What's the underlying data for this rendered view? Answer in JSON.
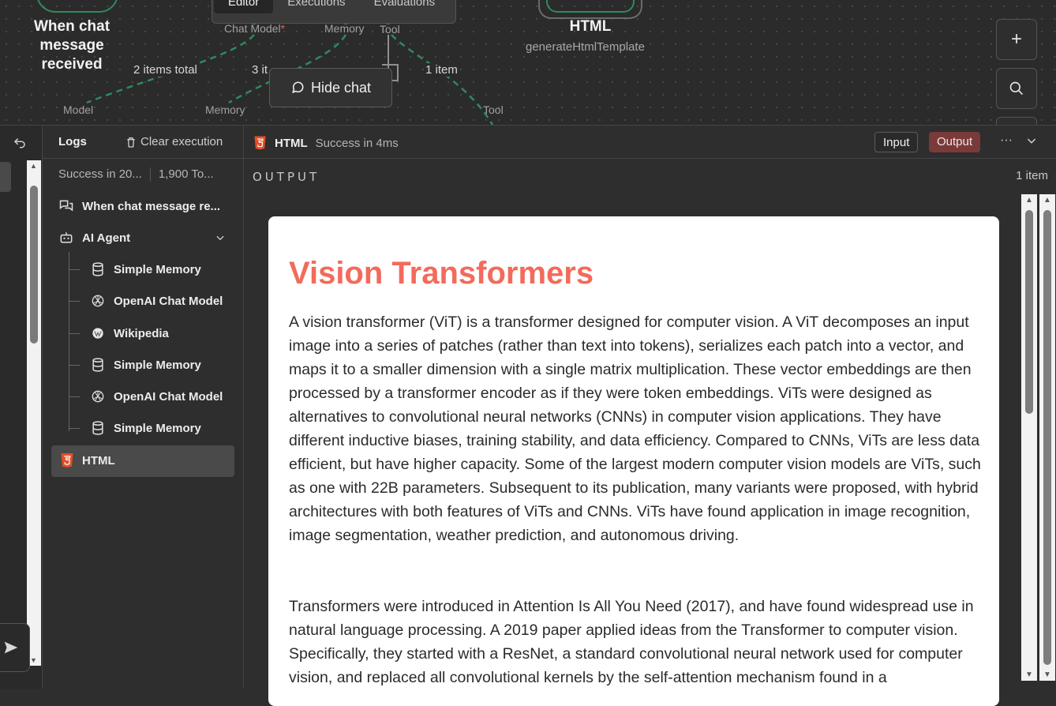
{
  "canvas": {
    "tabs": [
      "Editor",
      "Executions",
      "Evaluations"
    ],
    "trigger_node": {
      "title_line1": "When chat message",
      "title_line2": "received"
    },
    "html_node": {
      "title": "HTML",
      "subtitle": "generateHtmlTemplate"
    },
    "ports": {
      "chat_model": "Chat Model",
      "required_mark": "*",
      "memory": "Memory",
      "tool": "Tool"
    },
    "edge_labels": {
      "model_items": "2 items total",
      "memory_items": "3 it",
      "tool_items": "1 item"
    },
    "sub_labels": {
      "model": "Model",
      "memory": "Memory",
      "tool": "Tool"
    },
    "hide_chat_label": "Hide chat",
    "accent_color": "#2f8a5e"
  },
  "logs": {
    "title": "Logs",
    "clear_label": "Clear execution",
    "summary_status": "Success in 20...",
    "summary_tokens": "1,900 To...",
    "items": [
      {
        "label": "When chat message re...",
        "icon": "chat-icon"
      },
      {
        "label": "AI Agent",
        "icon": "robot-icon"
      },
      {
        "label": "Simple Memory",
        "icon": "database-icon"
      },
      {
        "label": "OpenAI Chat Model",
        "icon": "openai-icon"
      },
      {
        "label": "Wikipedia",
        "icon": "wikipedia-icon"
      },
      {
        "label": "Simple Memory",
        "icon": "database-icon"
      },
      {
        "label": "OpenAI Chat Model",
        "icon": "openai-icon"
      },
      {
        "label": "Simple Memory",
        "icon": "database-icon"
      },
      {
        "label": "HTML",
        "icon": "html5-icon"
      }
    ],
    "selected_item": "HTML"
  },
  "output": {
    "node_name": "HTML",
    "status": "Success in 4ms",
    "input_label": "Input",
    "output_label": "Output",
    "more_label": "···",
    "section_label": "OUTPUT",
    "item_count": "1 item",
    "content": {
      "heading": "Vision Transformers",
      "paragraph1": "A vision transformer (ViT) is a transformer designed for computer vision. A ViT decomposes an input image into a series of patches (rather than text into tokens), serializes each patch into a vector, and maps it to a smaller dimension with a single matrix multiplication. These vector embeddings are then processed by a transformer encoder as if they were token embeddings. ViTs were designed as alternatives to convolutional neural networks (CNNs) in computer vision applications. They have different inductive biases, training stability, and data efficiency. Compared to CNNs, ViTs are less data efficient, but have higher capacity. Some of the largest modern computer vision models are ViTs, such as one with 22B parameters. Subsequent to its publication, many variants were proposed, with hybrid architectures with both features of ViTs and CNNs. ViTs have found application in image recognition, image segmentation, weather prediction, and autonomous driving.",
      "paragraph2": "Transformers were introduced in Attention Is All You Need (2017), and have found widespread use in natural language processing. A 2019 paper applied ideas from the Transformer to computer vision. Specifically, they started with a ResNet, a standard convolutional neural network used for computer vision, and replaced all convolutional kernels by the self-attention mechanism found in a"
    },
    "heading_color": "#f26b5b",
    "output_button_color": "#7a3a3a"
  }
}
